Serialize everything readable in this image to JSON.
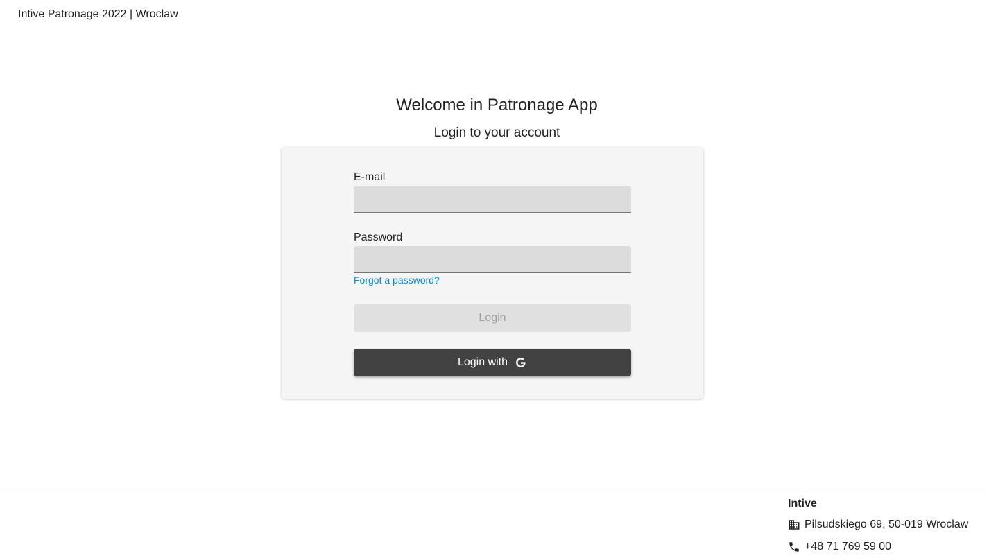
{
  "header": {
    "title": "Intive Patronage 2022 | Wroclaw"
  },
  "main": {
    "welcome": "Welcome in Patronage App",
    "subtitle": "Login to your account"
  },
  "form": {
    "email_label": "E-mail",
    "email_value": "",
    "password_label": "Password",
    "password_value": "",
    "forgot_link": "Forgot a password?",
    "login_button": "Login",
    "google_button": "Login with",
    "google_icon": "google-g-icon"
  },
  "footer": {
    "company": "Intive",
    "address": "Pilsudskiego 69, 50-019 Wroclaw",
    "address_icon": "building-icon",
    "phone": "+48 71 769 59 00",
    "phone_icon": "phone-icon"
  },
  "colors": {
    "link": "#0288d1",
    "google_button_bg": "#424242",
    "card_bg": "#f5f5f5"
  }
}
